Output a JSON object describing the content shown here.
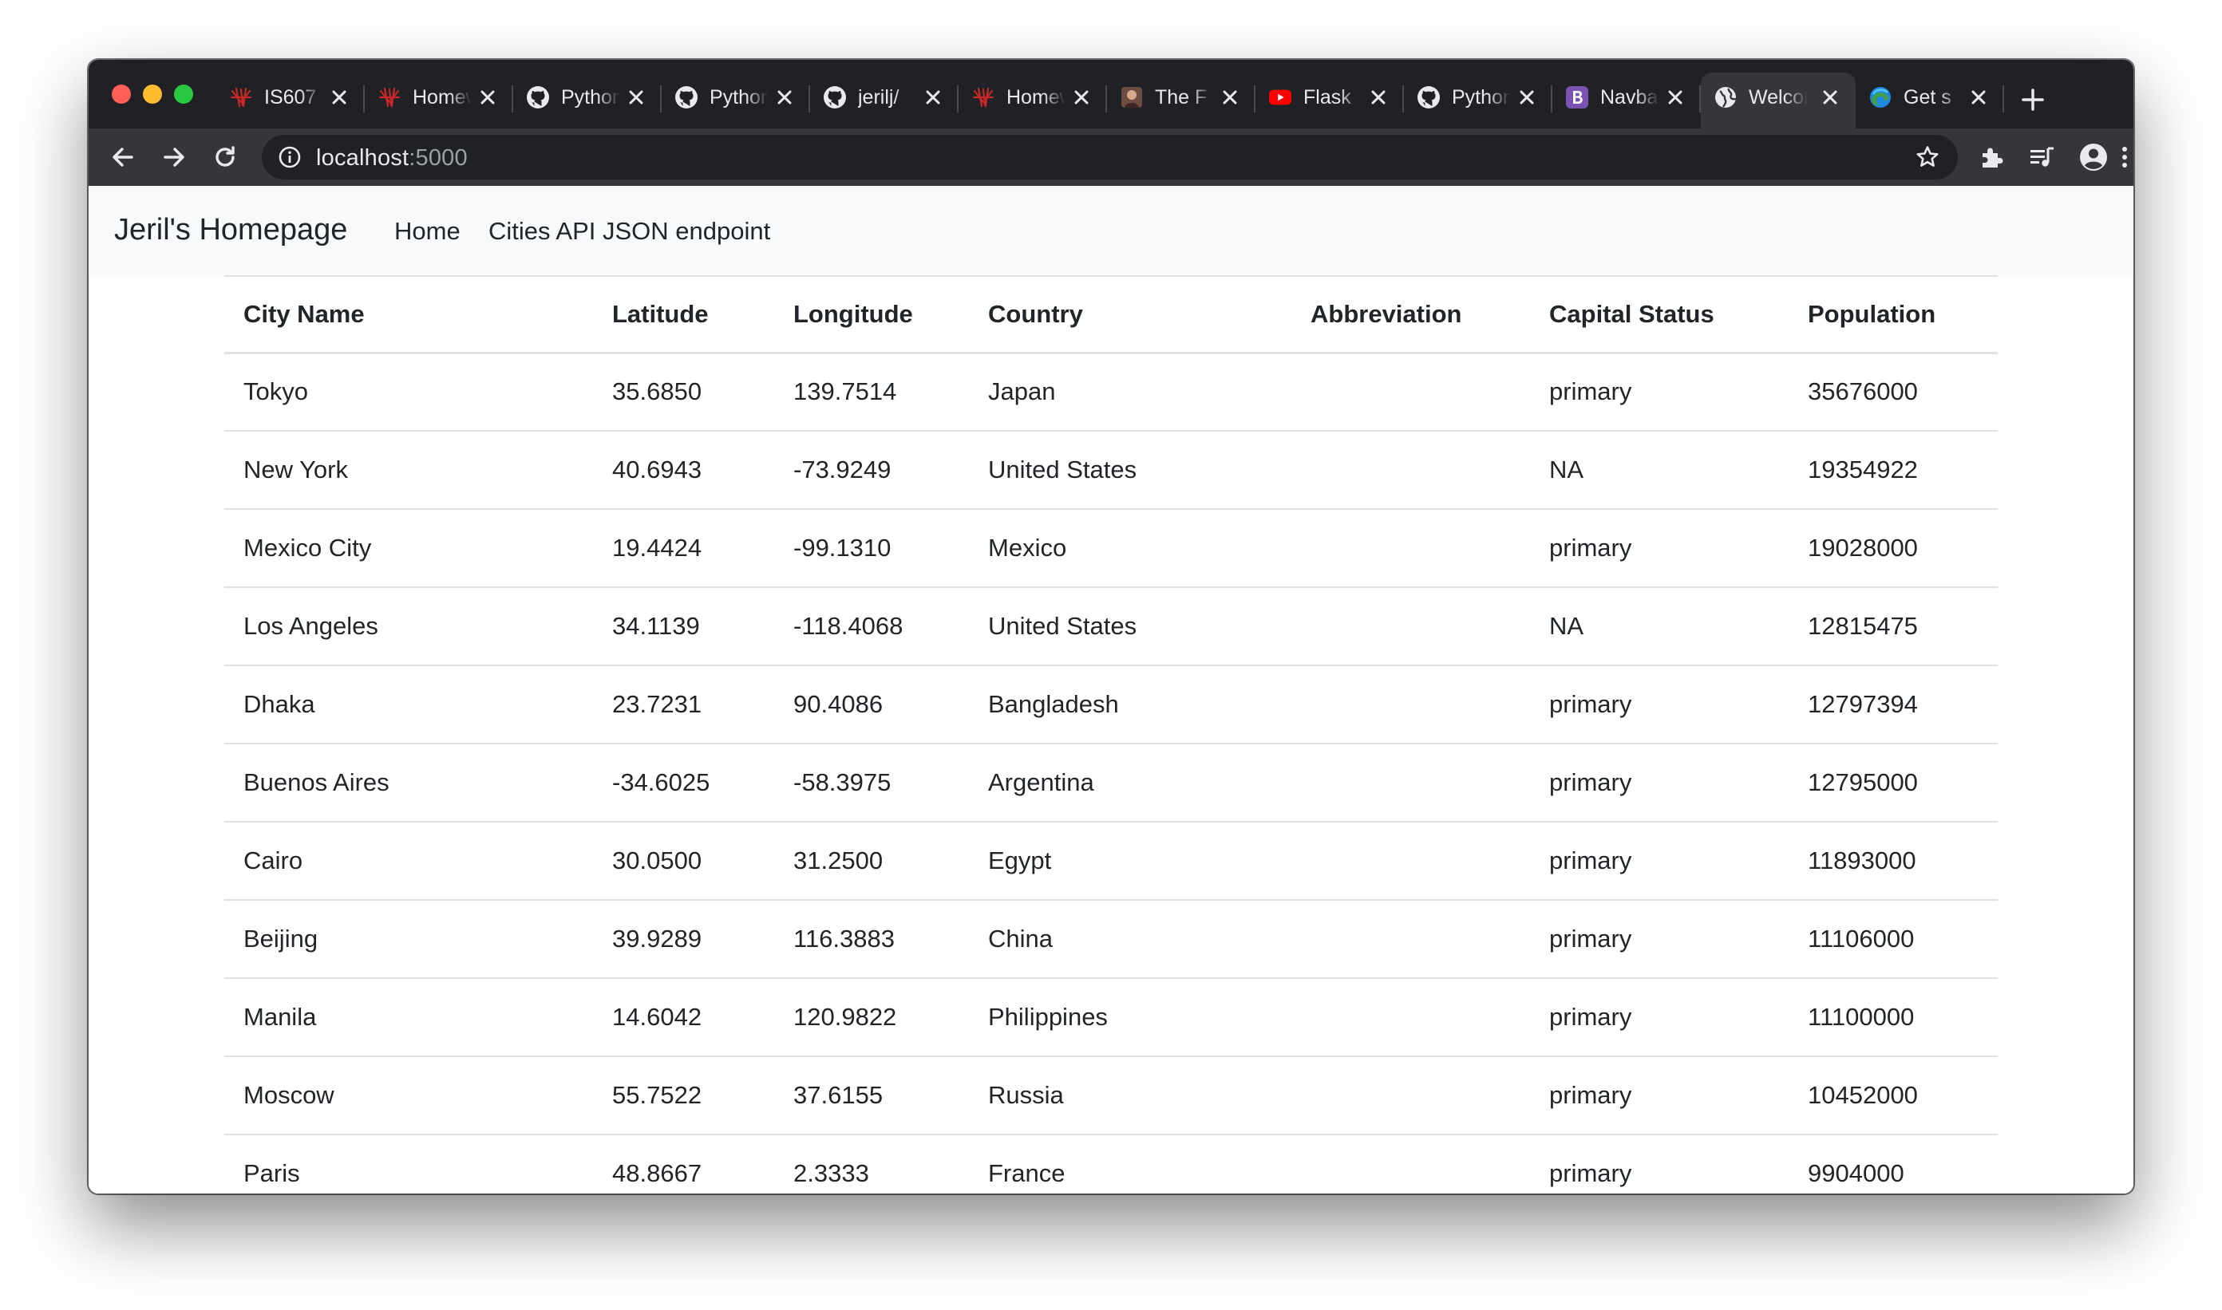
{
  "browser": {
    "tabs": [
      {
        "title": "IS607",
        "favicon": "red-logo-icon",
        "active": false
      },
      {
        "title": "Homework",
        "favicon": "red-logo-icon",
        "active": false
      },
      {
        "title": "Python",
        "favicon": "github-icon",
        "active": false
      },
      {
        "title": "Python",
        "favicon": "github-icon",
        "active": false
      },
      {
        "title": "jerilj/",
        "favicon": "github-icon",
        "active": false
      },
      {
        "title": "Homework",
        "favicon": "red-logo-icon",
        "active": false
      },
      {
        "title": "The F",
        "favicon": "avatar-icon",
        "active": false
      },
      {
        "title": "Flask",
        "favicon": "youtube-icon",
        "active": false
      },
      {
        "title": "Python",
        "favicon": "github-icon",
        "active": false
      },
      {
        "title": "Navbar",
        "favicon": "bootstrap-icon",
        "active": false
      },
      {
        "title": "Welcome",
        "favicon": "globe-icon",
        "active": true
      },
      {
        "title": "Get s",
        "favicon": "edge-icon",
        "active": false
      }
    ],
    "url_host": "localhost",
    "url_port": ":5000",
    "colors": {
      "frame": "#202124",
      "toolbar": "#35363a",
      "active_tab": "#35363a"
    }
  },
  "navbar": {
    "brand": "Jeril's Homepage",
    "links": [
      "Home",
      "Cities API JSON endpoint"
    ]
  },
  "table": {
    "headers": [
      "City Name",
      "Latitude",
      "Longitude",
      "Country",
      "Abbreviation",
      "Capital Status",
      "Population"
    ],
    "rows": [
      [
        "Tokyo",
        "35.6850",
        "139.7514",
        "Japan",
        "",
        "primary",
        "35676000"
      ],
      [
        "New York",
        "40.6943",
        "-73.9249",
        "United States",
        "",
        "NA",
        "19354922"
      ],
      [
        "Mexico City",
        "19.4424",
        "-99.1310",
        "Mexico",
        "",
        "primary",
        "19028000"
      ],
      [
        "Los Angeles",
        "34.1139",
        "-118.4068",
        "United States",
        "",
        "NA",
        "12815475"
      ],
      [
        "Dhaka",
        "23.7231",
        "90.4086",
        "Bangladesh",
        "",
        "primary",
        "12797394"
      ],
      [
        "Buenos Aires",
        "-34.6025",
        "-58.3975",
        "Argentina",
        "",
        "primary",
        "12795000"
      ],
      [
        "Cairo",
        "30.0500",
        "31.2500",
        "Egypt",
        "",
        "primary",
        "11893000"
      ],
      [
        "Beijing",
        "39.9289",
        "116.3883",
        "China",
        "",
        "primary",
        "11106000"
      ],
      [
        "Manila",
        "14.6042",
        "120.9822",
        "Philippines",
        "",
        "primary",
        "11100000"
      ],
      [
        "Moscow",
        "55.7522",
        "37.6155",
        "Russia",
        "",
        "primary",
        "10452000"
      ],
      [
        "Paris",
        "48.8667",
        "2.3333",
        "France",
        "",
        "primary",
        "9904000"
      ]
    ]
  }
}
